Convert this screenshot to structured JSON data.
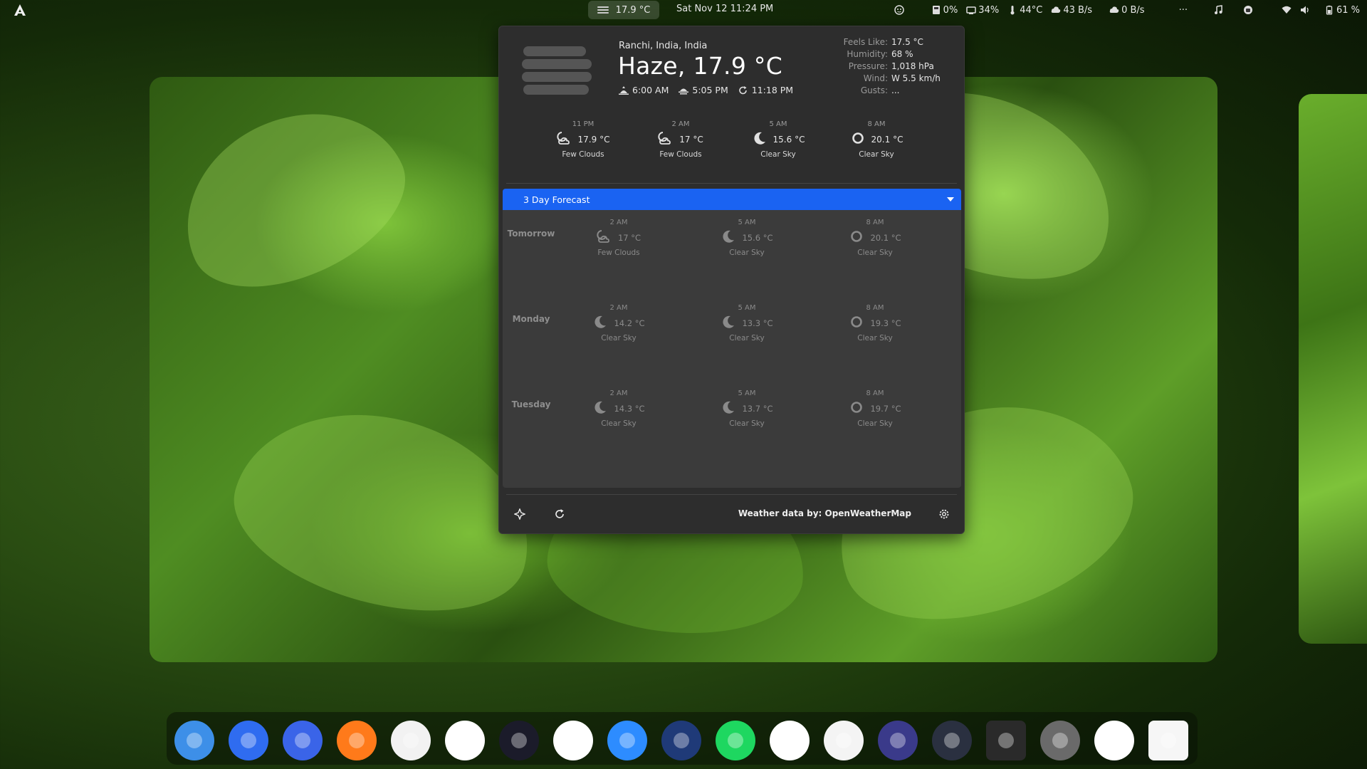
{
  "topbar": {
    "weather_temp": "17.9 °C",
    "clock": "Sat Nov 12  11:24 PM",
    "tray": {
      "disk": "0%",
      "cpu": "34%",
      "temp": "44°C",
      "upload": "43 B/s",
      "download": "0 B/s",
      "more": "···",
      "battery": "61 %"
    }
  },
  "weather": {
    "location": "Ranchi, India, India",
    "summary": "Haze, 17.9 °C",
    "sunrise": "6:00 AM",
    "sunset": "5:05 PM",
    "updated": "11:18 PM",
    "details": [
      {
        "label": "Feels Like:",
        "value": "17.5 °C"
      },
      {
        "label": "Humidity:",
        "value": "68 %"
      },
      {
        "label": "Pressure:",
        "value": "1,018 hPa"
      },
      {
        "label": "Wind:",
        "value": "W 5.5 km/h"
      },
      {
        "label": "Gusts:",
        "value": "..."
      }
    ],
    "hourly": [
      {
        "time": "11 PM",
        "temp": "17.9 °C",
        "desc": "Few Clouds",
        "icon": "few-clouds-night-icon"
      },
      {
        "time": "2 AM",
        "temp": "17 °C",
        "desc": "Few Clouds",
        "icon": "few-clouds-night-icon"
      },
      {
        "time": "5 AM",
        "temp": "15.6 °C",
        "desc": "Clear Sky",
        "icon": "moon-icon"
      },
      {
        "time": "8 AM",
        "temp": "20.1 °C",
        "desc": "Clear Sky",
        "icon": "sun-icon"
      }
    ],
    "forecast_header": "3 Day Forecast",
    "forecast": [
      {
        "day": "Tomorrow",
        "slots": [
          {
            "time": "2 AM",
            "temp": "17 °C",
            "desc": "Few Clouds",
            "icon": "few-clouds-night-icon"
          },
          {
            "time": "5 AM",
            "temp": "15.6 °C",
            "desc": "Clear Sky",
            "icon": "moon-icon"
          },
          {
            "time": "8 AM",
            "temp": "20.1 °C",
            "desc": "Clear Sky",
            "icon": "sun-icon"
          }
        ]
      },
      {
        "day": "Monday",
        "slots": [
          {
            "time": "2 AM",
            "temp": "14.2 °C",
            "desc": "Clear Sky",
            "icon": "moon-icon"
          },
          {
            "time": "5 AM",
            "temp": "13.3 °C",
            "desc": "Clear Sky",
            "icon": "moon-icon"
          },
          {
            "time": "8 AM",
            "temp": "19.3 °C",
            "desc": "Clear Sky",
            "icon": "sun-icon"
          }
        ]
      },
      {
        "day": "Tuesday",
        "slots": [
          {
            "time": "2 AM",
            "temp": "14.3 °C",
            "desc": "Clear Sky",
            "icon": "moon-icon"
          },
          {
            "time": "5 AM",
            "temp": "13.7 °C",
            "desc": "Clear Sky",
            "icon": "moon-icon"
          },
          {
            "time": "8 AM",
            "temp": "19.7 °C",
            "desc": "Clear Sky",
            "icon": "sun-icon"
          }
        ]
      }
    ],
    "credit": "Weather data by: OpenWeatherMap"
  },
  "colors": {
    "accent": "#1a63f2",
    "popup_bg": "#2d2d2d",
    "forecast_bg": "#3b3b3b"
  },
  "dock": [
    {
      "name": "toggle-app-icon",
      "bg": "#3d8fe8"
    },
    {
      "name": "blue-smile-app-icon",
      "bg": "#2f6cf0"
    },
    {
      "name": "files-app-icon",
      "bg": "#3a64e8"
    },
    {
      "name": "firefox-icon",
      "bg": "#ff7a1a"
    },
    {
      "name": "white-circle-app-icon",
      "bg": "#f2f2f2"
    },
    {
      "name": "layers-app-icon",
      "bg": "#ffffff"
    },
    {
      "name": "dark-swoosh-app-icon",
      "bg": "#1b1b2a"
    },
    {
      "name": "teams-icon",
      "bg": "#ffffff"
    },
    {
      "name": "zoom-icon",
      "bg": "#2d8cff"
    },
    {
      "name": "pixel-checker-app-icon",
      "bg": "#1f3a78"
    },
    {
      "name": "spotify-icon",
      "bg": "#1ed760"
    },
    {
      "name": "inkscape-icon",
      "bg": "#ffffff"
    },
    {
      "name": "calculator-icon",
      "bg": "#f4f4f4"
    },
    {
      "name": "waveform-app-icon",
      "bg": "#3a3a8a"
    },
    {
      "name": "gauge-app-icon",
      "bg": "#2a3040"
    },
    {
      "name": "mixer-app-icon",
      "bg": "#2a2a2a"
    },
    {
      "name": "disk-app-icon",
      "bg": "#6a6a6a"
    },
    {
      "name": "record-app-icon",
      "bg": "#ffffff"
    },
    {
      "name": "trash-icon",
      "bg": "#f6f6f6"
    }
  ]
}
